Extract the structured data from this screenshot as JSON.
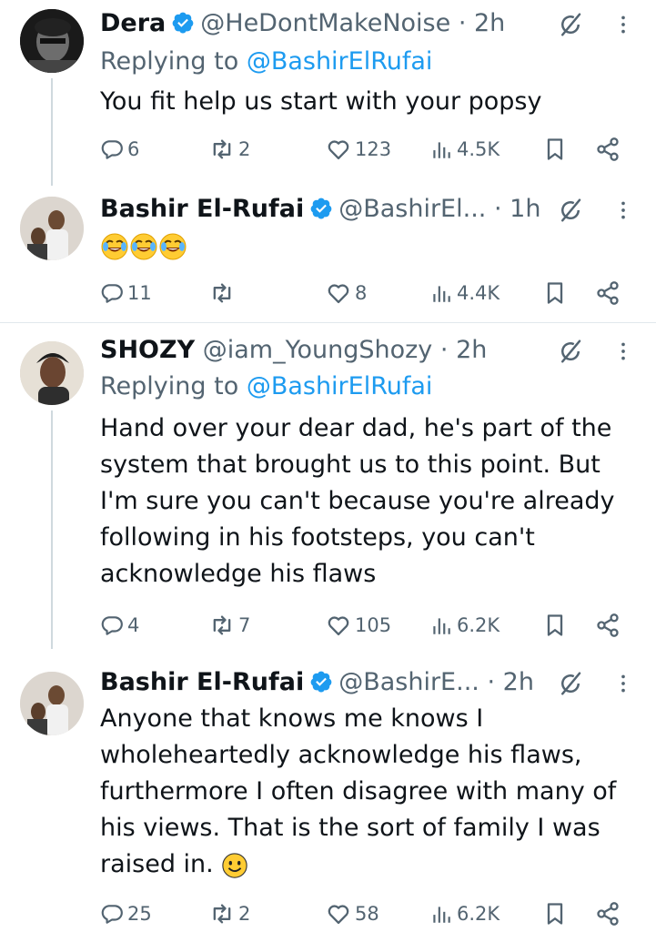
{
  "tweets": [
    {
      "name": "Dera",
      "handle": "@HeDontMakeNoise",
      "sep": "·",
      "time": "2h",
      "replying_prefix": "Replying to ",
      "replying_to": "@BashirElRufai",
      "text": "You fit help us start with your popsy",
      "replies": "6",
      "retweets": "2",
      "likes": "123",
      "views": "4.5K"
    },
    {
      "name": "Bashir El-Rufai",
      "handle": "@BashirEl...",
      "sep": "·",
      "time": "1h",
      "text_emoji": "🤣🤣🤣",
      "replies": "11",
      "retweets": "",
      "likes": "8",
      "views": "4.4K"
    },
    {
      "name": "SHOZY",
      "handle": "@iam_YoungShozy",
      "sep": "·",
      "time": "2h",
      "replying_prefix": "Replying to ",
      "replying_to": "@BashirElRufai",
      "text_lines": [
        "Hand over your dear dad, he's part of the",
        "system that brought us to this point. But",
        "I'm sure you can't because you're already",
        "following in his footsteps, you can't",
        "acknowledge his flaws"
      ],
      "replies": "4",
      "retweets": "7",
      "likes": "105",
      "views": "6.2K"
    },
    {
      "name": "Bashir El-Rufai",
      "handle": "@BashirE...",
      "sep": "·",
      "time": "2h",
      "text_lines": [
        "Anyone that knows me knows I",
        "wholeheartedly acknowledge his flaws,",
        "furthermore I often disagree with many of",
        "his views. That is the sort of family I was",
        "raised in."
      ],
      "replies": "25",
      "retweets": "2",
      "likes": "58",
      "views": "6.2K"
    }
  ],
  "colors": {
    "verified": "#1d9bf0",
    "text": "#0f1419",
    "secondary": "#536471",
    "link": "#1d9bf0"
  }
}
